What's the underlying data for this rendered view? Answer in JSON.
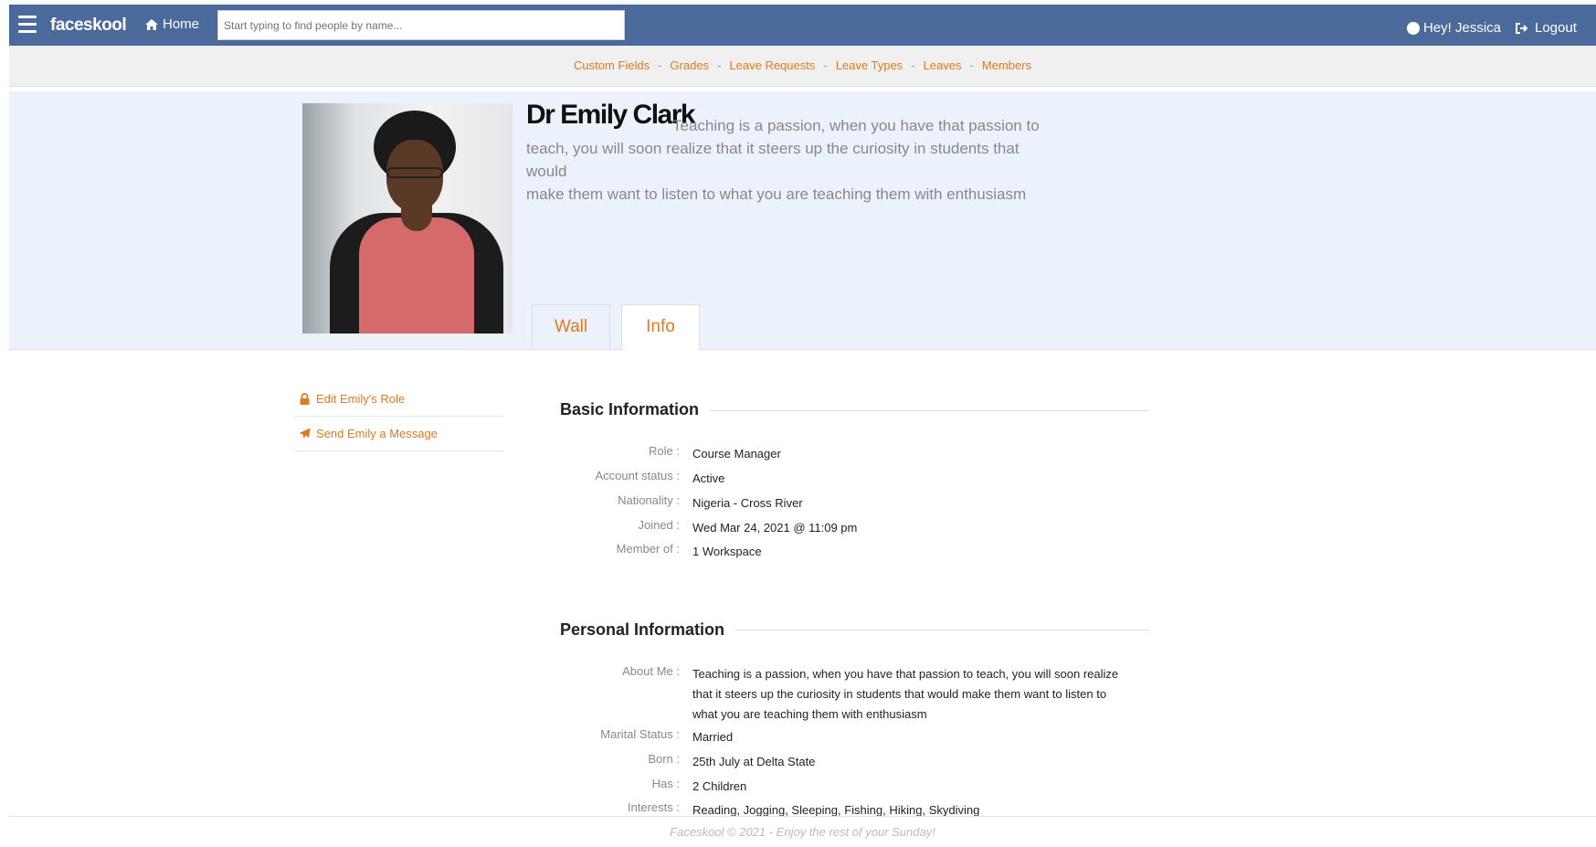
{
  "navbar": {
    "brand": "faceskool",
    "home_label": "Home",
    "search_placeholder": "Start typing to find people by name...",
    "greeting": "Hey! Jessica",
    "logout_label": "Logout"
  },
  "subnav": {
    "items": [
      "Custom Fields",
      "Grades",
      "Leave Requests",
      "Leave Types",
      "Leaves",
      "Members"
    ],
    "separator": "-"
  },
  "profile": {
    "name": "Dr Emily Clark",
    "bio_line1": "Teaching is a passion, when you have that passion to",
    "bio_line2": "teach, you will soon realize that it steers up the curiosity in students that would",
    "bio_line3": "make them want to listen to what you are teaching them with enthusiasm"
  },
  "tabs": [
    {
      "label": "Wall",
      "active": false
    },
    {
      "label": "Info",
      "active": true
    }
  ],
  "actions": [
    {
      "label": "Edit Emily's Role",
      "icon": "lock-icon"
    },
    {
      "label": "Send Emily a Message",
      "icon": "paper-plane-icon"
    }
  ],
  "basic_info": {
    "title": "Basic Information",
    "rows": [
      {
        "label": "Role :",
        "value": "Course Manager"
      },
      {
        "label": "Account status :",
        "value": "Active"
      },
      {
        "label": "Nationality :",
        "value": "Nigeria - Cross River"
      },
      {
        "label": "Joined :",
        "value": "Wed Mar 24, 2021 @ 11:09 pm"
      },
      {
        "label": "Member of :",
        "value": "1 Workspace"
      }
    ]
  },
  "personal_info": {
    "title": "Personal Information",
    "rows": [
      {
        "label": "About Me :",
        "value": "Teaching is a passion, when you have that passion to teach, you will soon realize that it steers up the curiosity in students that would make them want to listen to what you are teaching them with enthusiasm"
      },
      {
        "label": "Marital Status :",
        "value": "Married"
      },
      {
        "label": "Born :",
        "value": "25th July at Delta State"
      },
      {
        "label": "Has :",
        "value": "2 Children"
      },
      {
        "label": "Interests :",
        "value": "Reading, Jogging, Sleeping, Fishing, Hiking, Skydiving"
      }
    ]
  },
  "footer": {
    "text": "Faceskool © 2021 - Enjoy the rest of your Sunday!"
  },
  "colors": {
    "navbar": "#4a6a9c",
    "accent": "#e07a20",
    "header_bg": "#ecf2fb"
  }
}
